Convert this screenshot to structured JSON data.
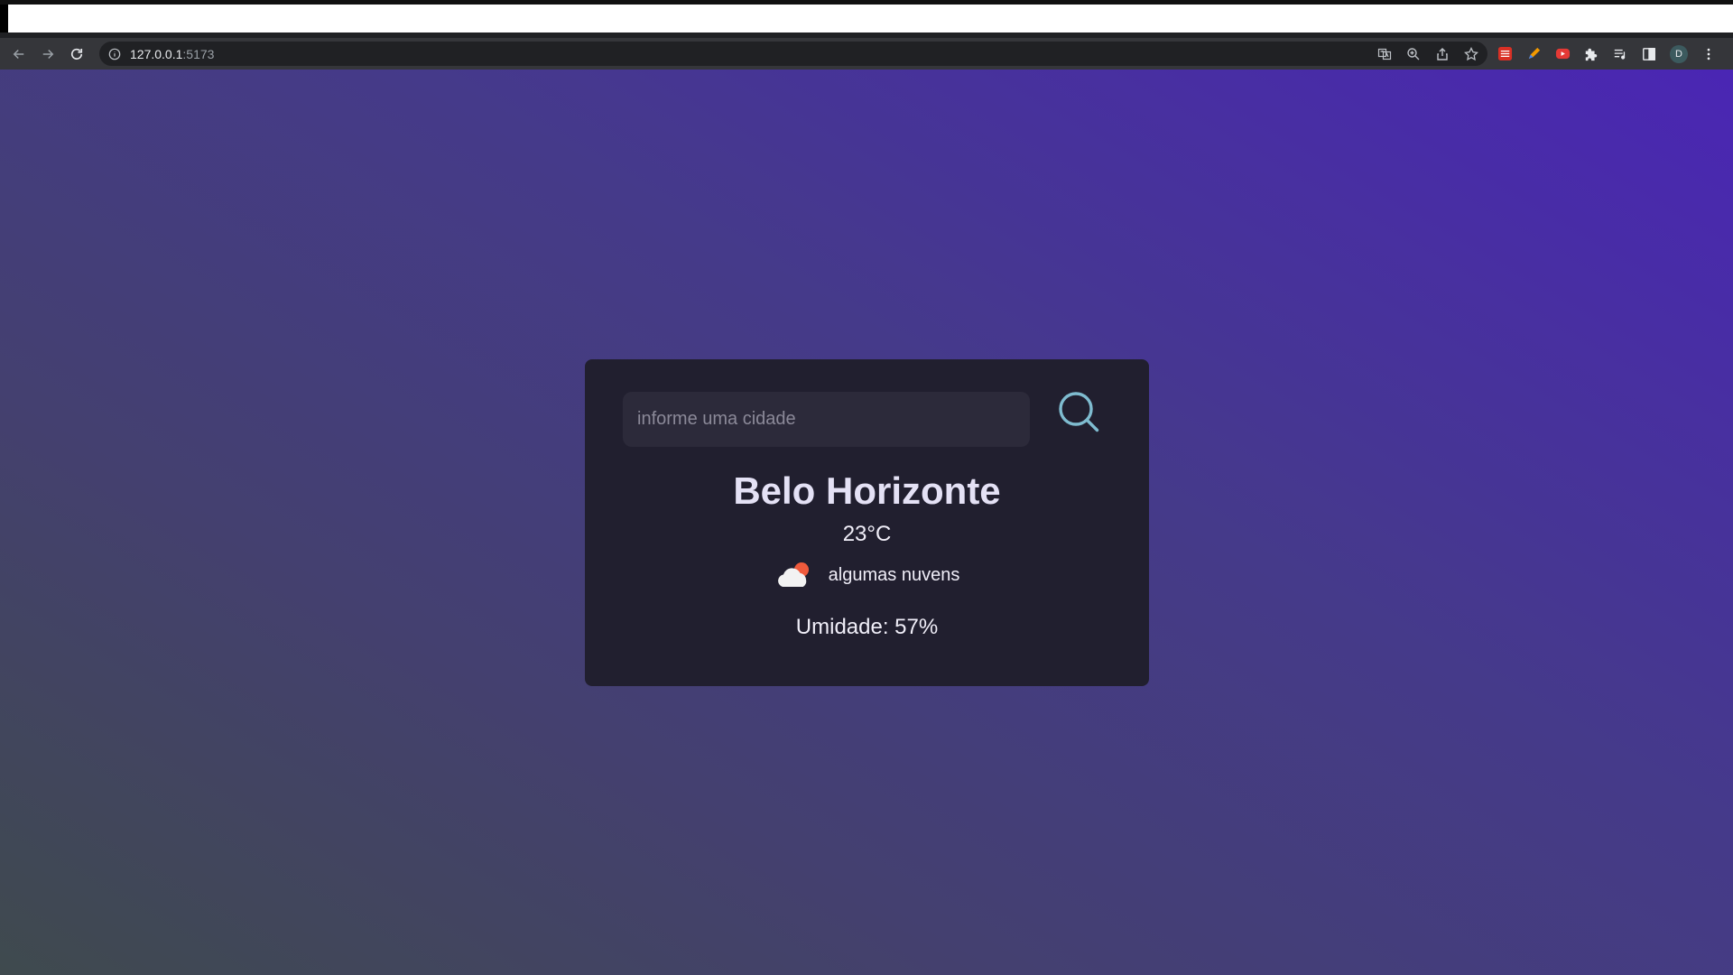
{
  "browser": {
    "url_host": "127.0.0.1",
    "url_port": ":5173",
    "profile_initial": "D"
  },
  "weather": {
    "search_placeholder": "informe uma cidade",
    "city": "Belo Horizonte",
    "temperature": "23°C",
    "description": "algumas nuvens",
    "humidity": "Umidade: 57%",
    "icon": "few-clouds-icon"
  },
  "colors": {
    "card_bg": "#211f2f",
    "search_icon": "#7fbcd0",
    "text": "#f0eef8"
  }
}
